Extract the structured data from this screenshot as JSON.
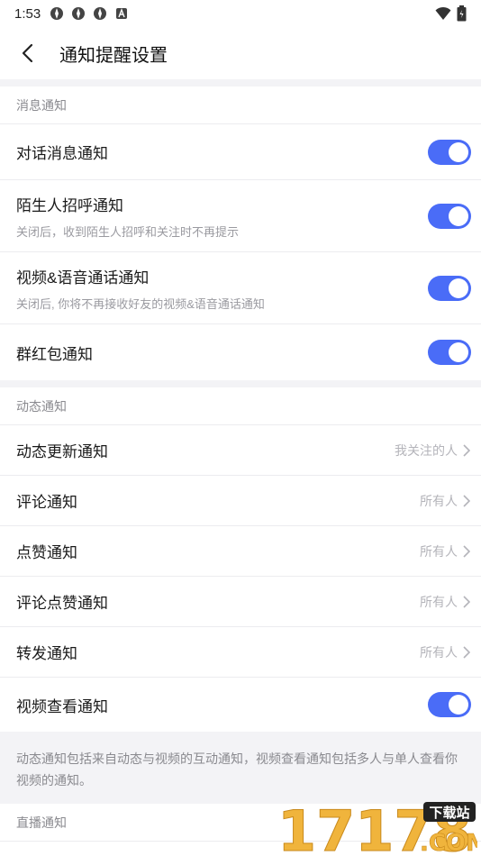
{
  "status_bar": {
    "time": "1:53",
    "icons": [
      "app-icon",
      "app-icon",
      "app-icon",
      "notification-a-icon"
    ],
    "right_icons": [
      "wifi-icon",
      "battery-icon"
    ]
  },
  "header": {
    "back_icon": "chevron-left-icon",
    "title": "通知提醒设置"
  },
  "message_section": {
    "title": "消息通知",
    "rows": [
      {
        "label": "对话消息通知",
        "toggle": true
      },
      {
        "label": "陌生人招呼通知",
        "sub": "关闭后，收到陌生人招呼和关注时不再提示",
        "toggle": true
      },
      {
        "label": "视频&语音通话通知",
        "sub": "关闭后, 你将不再接收好友的视频&语音通话通知",
        "toggle": true
      },
      {
        "label": "群红包通知",
        "toggle": true
      }
    ]
  },
  "dynamic_section": {
    "title": "动态通知",
    "rows": [
      {
        "label": "动态更新通知",
        "value": "我关注的人"
      },
      {
        "label": "评论通知",
        "value": "所有人"
      },
      {
        "label": "点赞通知",
        "value": "所有人"
      },
      {
        "label": "评论点赞通知",
        "value": "所有人"
      },
      {
        "label": "转发通知",
        "value": "所有人"
      },
      {
        "label": "视频查看通知",
        "toggle": true
      }
    ]
  },
  "note": "动态通知包括来自动态与视频的互动通知，视频查看通知包括多人与单人查看你视频的通知。",
  "live_section": {
    "title": "直播通知"
  },
  "watermark": {
    "number": "17178",
    "tag": "下载站",
    "domain": ".COM"
  },
  "colors": {
    "accent": "#4a6cf7",
    "background": "#f3f3f6",
    "secondary_text": "#8a8a8f",
    "watermark": "#f0b43c"
  }
}
